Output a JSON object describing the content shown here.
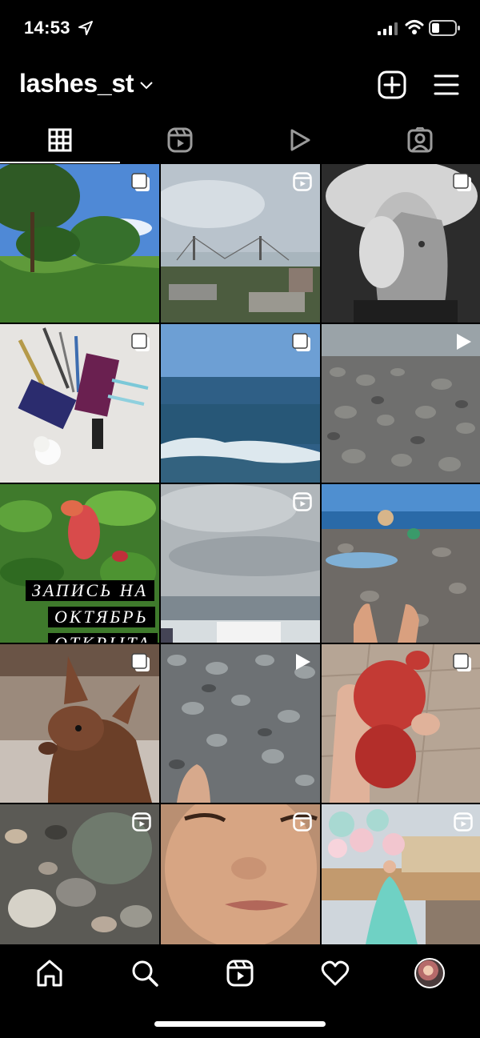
{
  "status_bar": {
    "time": "14:53",
    "icons": [
      "location-arrow-icon",
      "signal-icon",
      "wifi-icon",
      "battery-icon"
    ]
  },
  "header": {
    "username": "lashes_st",
    "icons": [
      "chevron-down-icon",
      "add-post-icon",
      "menu-icon"
    ]
  },
  "tabs": [
    {
      "name": "grid",
      "icon": "grid-icon",
      "active": true
    },
    {
      "name": "reels",
      "icon": "reels-icon",
      "active": false
    },
    {
      "name": "videos",
      "icon": "play-icon",
      "active": false
    },
    {
      "name": "tagged",
      "icon": "tagged-icon",
      "active": false
    }
  ],
  "grid": {
    "posts": [
      {
        "subject": "park trees",
        "badge": "carousel"
      },
      {
        "subject": "city bridge",
        "badge": "reel"
      },
      {
        "subject": "woman in hat portrait",
        "badge": "carousel"
      },
      {
        "subject": "lash extension tools",
        "badge": "carousel"
      },
      {
        "subject": "sea waves",
        "badge": "carousel"
      },
      {
        "subject": "pebble beach",
        "badge": "video"
      },
      {
        "subject": "pomegranate flower",
        "badge": "none",
        "text_lines": [
          "ЗАПИСЬ НА",
          "ОКТЯБРЬ",
          "ОТКРЫТА"
        ]
      },
      {
        "subject": "cloudy sea",
        "badge": "reel"
      },
      {
        "subject": "child on beach",
        "badge": "none"
      },
      {
        "subject": "chihuahua dog",
        "badge": "carousel"
      },
      {
        "subject": "pebbles and feet",
        "badge": "video"
      },
      {
        "subject": "red pomegranate ornament",
        "badge": "carousel"
      },
      {
        "subject": "wet pebbles",
        "badge": "reel"
      },
      {
        "subject": "face close-up",
        "badge": "reel"
      },
      {
        "subject": "balloons and dress",
        "badge": "reel"
      }
    ]
  },
  "bottom_nav": [
    "home-icon",
    "search-icon",
    "reels-nav-icon",
    "heart-icon",
    "profile-avatar"
  ],
  "colors": {
    "background": "#000000",
    "foreground": "#ffffff"
  }
}
